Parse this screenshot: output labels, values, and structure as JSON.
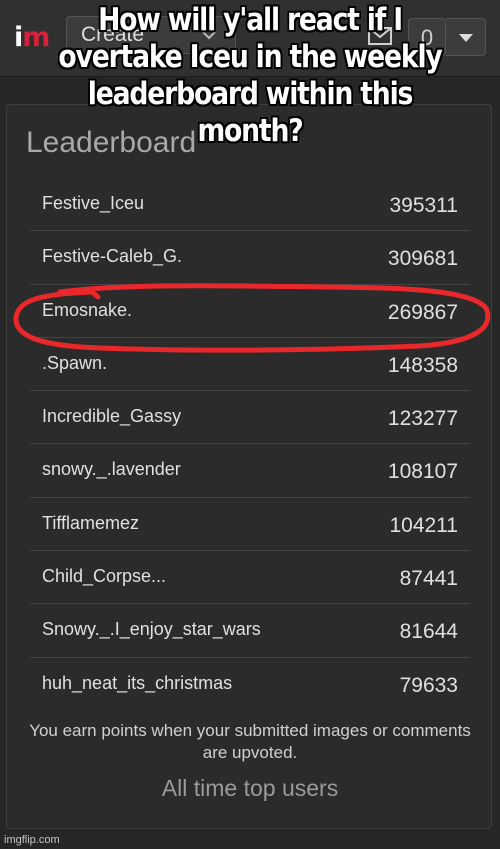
{
  "app": {
    "logo_letters": [
      "i",
      "m"
    ],
    "brand_color": "#d6213a",
    "icons": [
      "mail-icon",
      "chevron-down-icon"
    ]
  },
  "toolbar": {
    "create_label": "Create",
    "notification_count": "0"
  },
  "leaderboard": {
    "title": "Leaderboard",
    "rows": [
      {
        "username": "Festive_Iceu",
        "points": "395311"
      },
      {
        "username": "Festive-Caleb_G.",
        "points": "309681"
      },
      {
        "username": "Emosnake.",
        "points": "269867"
      },
      {
        "username": ".Spawn.",
        "points": "148358"
      },
      {
        "username": "Incredible_Gassy",
        "points": "123277"
      },
      {
        "username": "snowy._.lavender",
        "points": "108107"
      },
      {
        "username": "Tifflamemez",
        "points": "104211"
      },
      {
        "username": "Child_Corpse...",
        "points": "87441"
      },
      {
        "username": "Snowy._.I_enjoy_star_wars",
        "points": "81644"
      },
      {
        "username": "huh_neat_its_christmas",
        "points": "79633"
      }
    ],
    "highlighted_row": 2,
    "highlight_color": "#e8282b",
    "footnote": "You earn points when your submitted images or comments are upvoted.",
    "all_time_link": "All time top users"
  },
  "caption": "How will y'all react if I overtake Iceu in the weekly leaderboard within this month?",
  "watermark": "imgflip.com"
}
